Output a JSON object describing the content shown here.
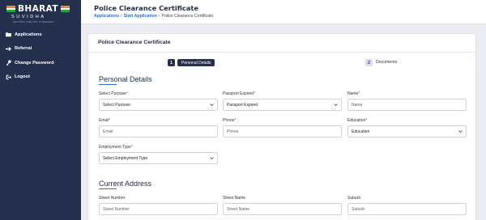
{
  "brand": {
    "name": "BHARAT",
    "sub": "SUVIDHA",
    "tagline": "HELPING INDIANS OVERSEAS"
  },
  "sidebar": {
    "items": [
      {
        "label": "Applications",
        "icon": "folder-icon"
      },
      {
        "label": "Referral",
        "icon": "arrow-right-icon"
      },
      {
        "label": "Change Password",
        "icon": "key-icon"
      },
      {
        "label": "Logout",
        "icon": "logout-icon"
      }
    ]
  },
  "header": {
    "title": "Police Clearance Certificate",
    "breadcrumb": [
      "Applications",
      "Start Application",
      "Police Clearance Certificate"
    ]
  },
  "card": {
    "title": "Police Clearance Certificate"
  },
  "steps": [
    {
      "number": "1",
      "label": "Personal Details",
      "active": true
    },
    {
      "number": "2",
      "label": "Documents",
      "active": false
    }
  ],
  "personal_details": {
    "title": "Personal Details",
    "fields": {
      "purpose": {
        "label": "Select Purpose",
        "required": "*",
        "value": "Select Purpose",
        "type": "select"
      },
      "passport_expired": {
        "label": "Passport Expired",
        "required": "*",
        "value": "Passport Expired",
        "type": "select"
      },
      "name": {
        "label": "Name",
        "required": "*",
        "placeholder": "Name",
        "type": "input"
      },
      "email": {
        "label": "Email",
        "required": "*",
        "placeholder": "Email",
        "type": "input"
      },
      "phone": {
        "label": "Phone",
        "required": "*",
        "placeholder": "Phone",
        "type": "input"
      },
      "education": {
        "label": "Education",
        "required": "*",
        "value": "Education",
        "type": "select"
      },
      "employment_type": {
        "label": "Employment Type",
        "required": "*",
        "value": "Select Employment Type",
        "type": "select"
      }
    }
  },
  "current_address": {
    "title": "Current Address",
    "fields": {
      "street_number": {
        "label": "Street Number",
        "placeholder": "Street Number"
      },
      "street_name": {
        "label": "Street Name",
        "placeholder": "Street Name"
      },
      "suburb": {
        "label": "Suburb",
        "placeholder": "Suburb"
      }
    }
  },
  "colors": {
    "sidebar": "#25304e",
    "accent": "#3366cc",
    "required": "#d83030"
  }
}
